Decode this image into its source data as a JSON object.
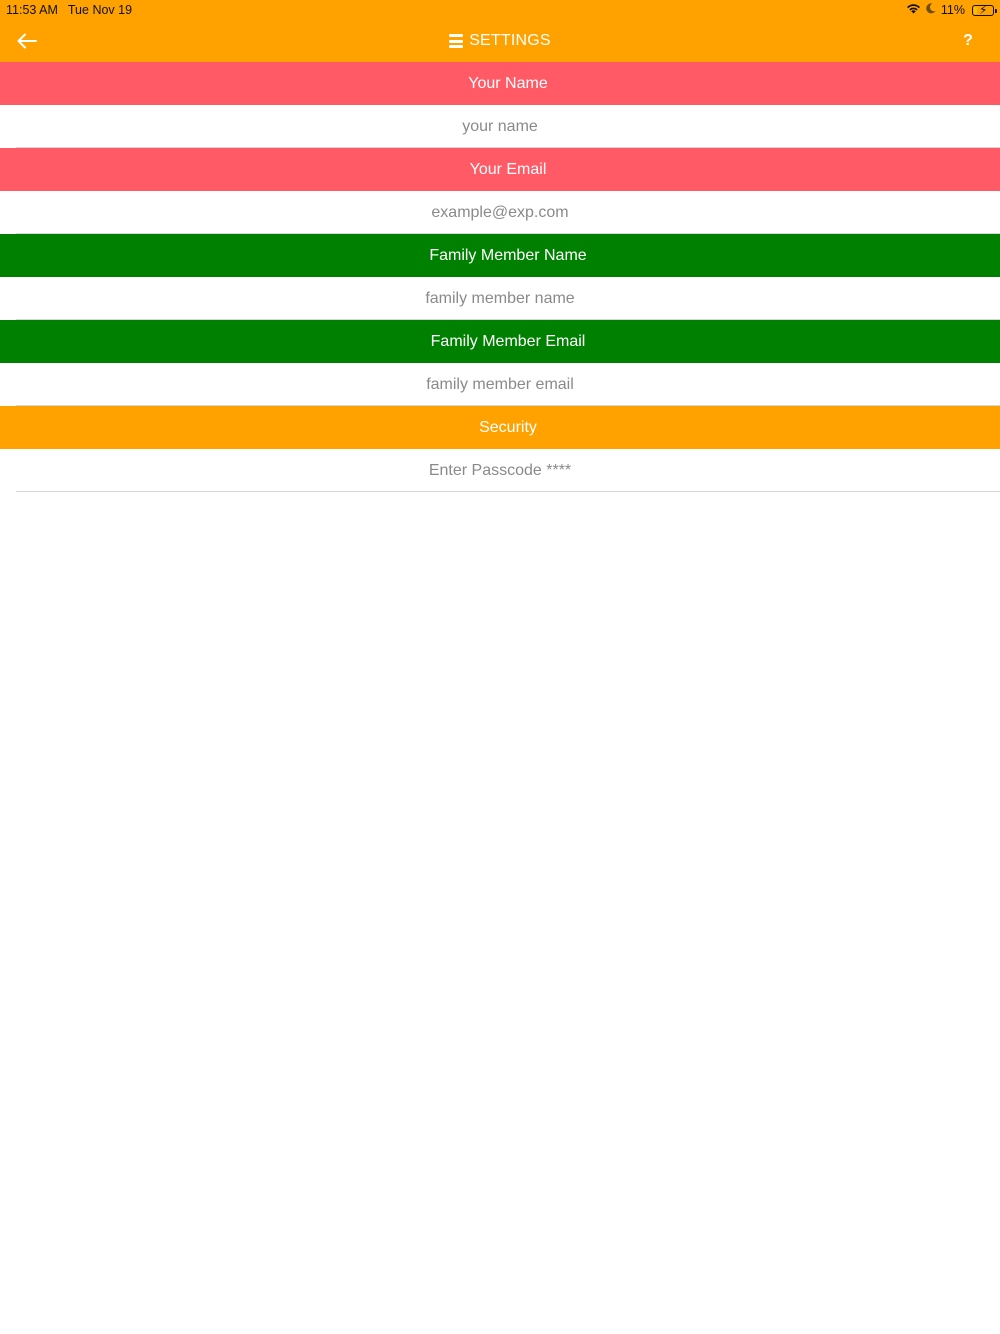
{
  "status_bar": {
    "time": "11:53 AM",
    "date": "Tue Nov 19",
    "battery": "11%",
    "icons": [
      "wifi-icon",
      "moon-icon",
      "battery-charging-icon"
    ]
  },
  "nav": {
    "title": "SETTINGS",
    "back_icon": "back-arrow-icon",
    "menu_icon": "menu-icon",
    "help_label": "?"
  },
  "sections": [
    {
      "header": "Your Name",
      "color": "#ff5a65",
      "placeholder": "your name",
      "value": ""
    },
    {
      "header": "Your Email",
      "color": "#ff5a65",
      "placeholder": "example@exp.com",
      "value": ""
    },
    {
      "header": "Family Member Name",
      "color": "#008000",
      "placeholder": "family member name",
      "value": ""
    },
    {
      "header": "Family Member Email",
      "color": "#008000",
      "placeholder": "family member email",
      "value": ""
    },
    {
      "header": "Security",
      "color": "#ffa200",
      "placeholder": "Enter Passcode ****",
      "value": ""
    }
  ],
  "colors": {
    "accent": "#ffa200",
    "red": "#ff5a65",
    "green": "#008000"
  }
}
